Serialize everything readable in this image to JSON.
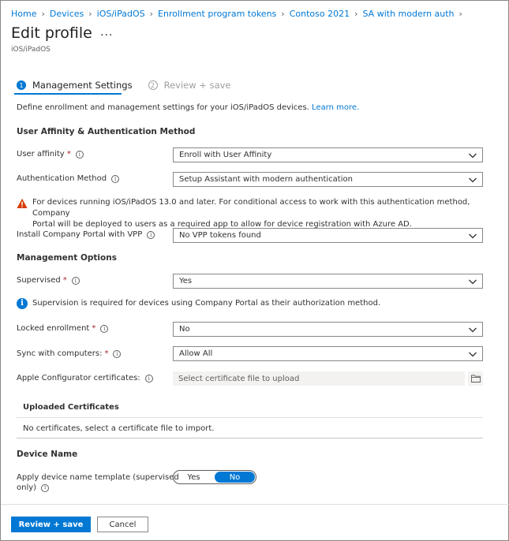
{
  "breadcrumb": [
    "Home",
    "Devices",
    "iOS/iPadOS",
    "Enrollment program tokens",
    "Contoso 2021",
    "SA with modern auth"
  ],
  "page": {
    "title": "Edit profile",
    "more": "...",
    "subtitle": "iOS/iPadOS"
  },
  "wizard": {
    "steps": [
      {
        "num": "1",
        "label": "Management Settings"
      },
      {
        "num": "2",
        "label": "Review + save"
      }
    ]
  },
  "description": {
    "text": "Define enrollment and management settings for your iOS/iPadOS devices.",
    "link": "Learn more."
  },
  "sections": {
    "affinity": "User Affinity & Authentication Method",
    "management": "Management Options",
    "device_name": "Device Name"
  },
  "fields": {
    "user_affinity": {
      "label": "User affinity",
      "value": "Enroll with User Affinity"
    },
    "auth_method": {
      "label": "Authentication Method",
      "value": "Setup Assistant with modern authentication"
    },
    "company_portal": {
      "label": "Install Company Portal with VPP",
      "value": "No VPP tokens found"
    },
    "supervised": {
      "label": "Supervised",
      "value": "Yes"
    },
    "locked": {
      "label": "Locked enrollment",
      "value": "No"
    },
    "sync": {
      "label": "Sync with computers:",
      "value": "Allow All"
    },
    "certs": {
      "label": "Apple Configurator certificates:",
      "placeholder": "Select certificate file to upload"
    },
    "device_template": {
      "label_line1": "Apply device name template (supervised",
      "label_line2": "only)"
    }
  },
  "required_mark": "*",
  "info_glyph": "i",
  "warning": {
    "line1": "For devices running iOS/iPadOS 13.0 and later. For conditional access to work with this authentication method, Company",
    "line2": "Portal will be deployed to users as a required app to allow for device registration with Azure AD."
  },
  "note": {
    "text": "Supervision is required for devices using Company Portal as their authorization method."
  },
  "uploaded": {
    "title": "Uploaded Certificates",
    "empty": "No certificates, select a certificate file to import."
  },
  "toggle": {
    "yes": "Yes",
    "no": "No",
    "selected": "No"
  },
  "footer": {
    "primary": "Review + save",
    "secondary": "Cancel"
  },
  "colors": {
    "accent": "#0078d4",
    "required": "#a4262c",
    "warning": "#d83b01"
  }
}
